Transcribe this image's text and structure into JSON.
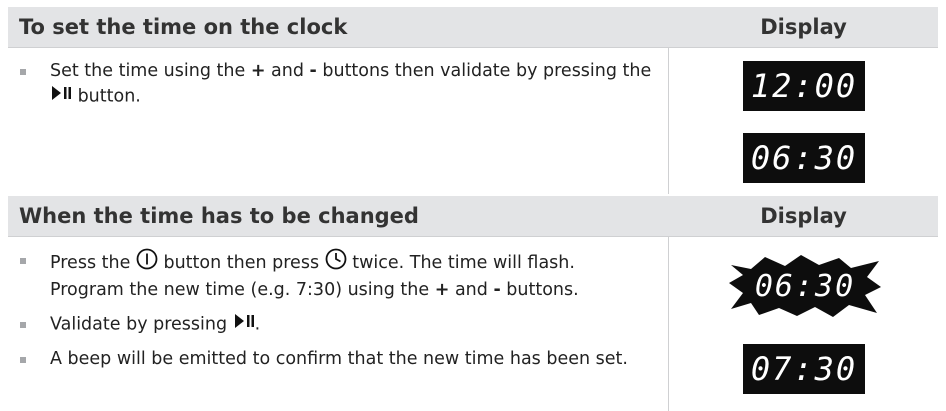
{
  "section1": {
    "title": "To set the time on the clock",
    "display_label": "Display",
    "bullet": {
      "part1": "Set the time using the ",
      "plus": "+",
      "part2": " and ",
      "minus": "-",
      "part3": " buttons then validate by pressing the ",
      "part4": " button."
    },
    "displays": [
      "12:00",
      "06:30"
    ]
  },
  "section2": {
    "title": "When the time has to be changed",
    "display_label": "Display",
    "bullet1": {
      "part1": "Press the ",
      "part2": " button then press ",
      "part3": " twice. The time will flash. Program the new time (e.g. 7:30) using the ",
      "plus": "+",
      "part4": " and ",
      "minus": "-",
      "part5": " buttons."
    },
    "bullet2": {
      "part1": "Validate by pressing ",
      "part2": "."
    },
    "bullet3": "A beep will be emitted to confirm that the new time has been set.",
    "displays": [
      "06:30",
      "07:30"
    ]
  },
  "icons": {
    "play_pause": "play-pause-icon",
    "power": "power-icon",
    "clock": "clock-icon"
  },
  "colors": {
    "header_bg": "#e3e4e6",
    "lcd_bg": "#0d0d0d",
    "bullet": "#a5a7aa"
  }
}
